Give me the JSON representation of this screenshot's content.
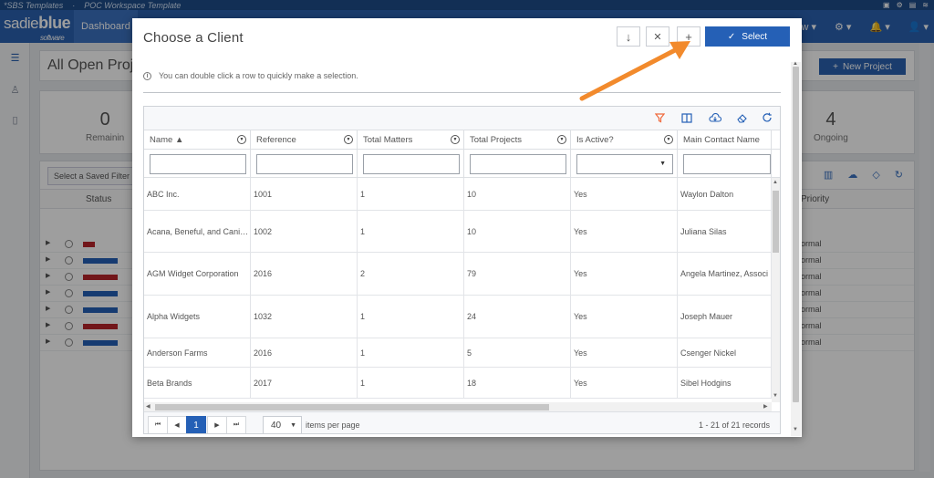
{
  "topstrip": {
    "items": [
      "*SBS Templates",
      "POC Workspace Template"
    ]
  },
  "navbar": {
    "logo_text": "sadie",
    "logo_bold": "blue",
    "logo_sub": "software",
    "tab_dashboard": "Dashboard",
    "right_items": [
      "ew ▾",
      "⚙ ▾",
      "🔔 ▾",
      "👤 ▾"
    ]
  },
  "background": {
    "page_title": "All Open Proj",
    "new_project_label": "New Project",
    "stats": [
      {
        "num": "0",
        "label": "Remainin"
      },
      {
        "num": "4",
        "label": "Ongoing"
      }
    ],
    "saved_filter_placeholder": "Select a Saved Filter",
    "head_status": "Status",
    "head_priority": "Priority",
    "priority_values": [
      "ormal",
      "ormal",
      "ormal",
      "ormal",
      "ormal",
      "ormal",
      "ormal"
    ],
    "bar_colors": [
      "#b8242a",
      "#2560b6",
      "#b8242a",
      "#2560b6",
      "#2560b6",
      "#b8242a",
      "#2560b6"
    ]
  },
  "dialog": {
    "title": "Choose a Client",
    "select_label": "Select",
    "hint": "You can double click a row to quickly make a selection.",
    "columns": [
      {
        "label": "Name ▲"
      },
      {
        "label": "Reference"
      },
      {
        "label": "Total Matters"
      },
      {
        "label": "Total Projects"
      },
      {
        "label": "Is Active?"
      },
      {
        "label": "Main Contact Name"
      }
    ],
    "rows": [
      [
        "ABC Inc.",
        "1001",
        "1",
        "10",
        "Yes",
        "Waylon Dalton"
      ],
      [
        "Acana, Beneful, and Cani…",
        "1002",
        "1",
        "10",
        "Yes",
        "Juliana Silas"
      ],
      [
        "AGM Widget Corporation",
        "2016",
        "2",
        "79",
        "Yes",
        "Angela Martinez, Associ"
      ],
      [
        "Alpha Widgets",
        "1032",
        "1",
        "24",
        "Yes",
        "Joseph Mauer"
      ],
      [
        "Anderson Farms",
        "2016",
        "1",
        "5",
        "Yes",
        "Csenger Nickel"
      ],
      [
        "Beta Brands",
        "2017",
        "1",
        "18",
        "Yes",
        "Sibel Hodgins"
      ]
    ],
    "pager": {
      "current_page": "1",
      "page_size": "40",
      "items_per_page_label": "items per page",
      "records_info": "1 - 21 of 21 records"
    }
  },
  "colors": {
    "primary": "#2560b6",
    "nav": "#2b62b1",
    "annotation_arrow": "#f28a2c",
    "filter_icon": "#f06a3c"
  }
}
